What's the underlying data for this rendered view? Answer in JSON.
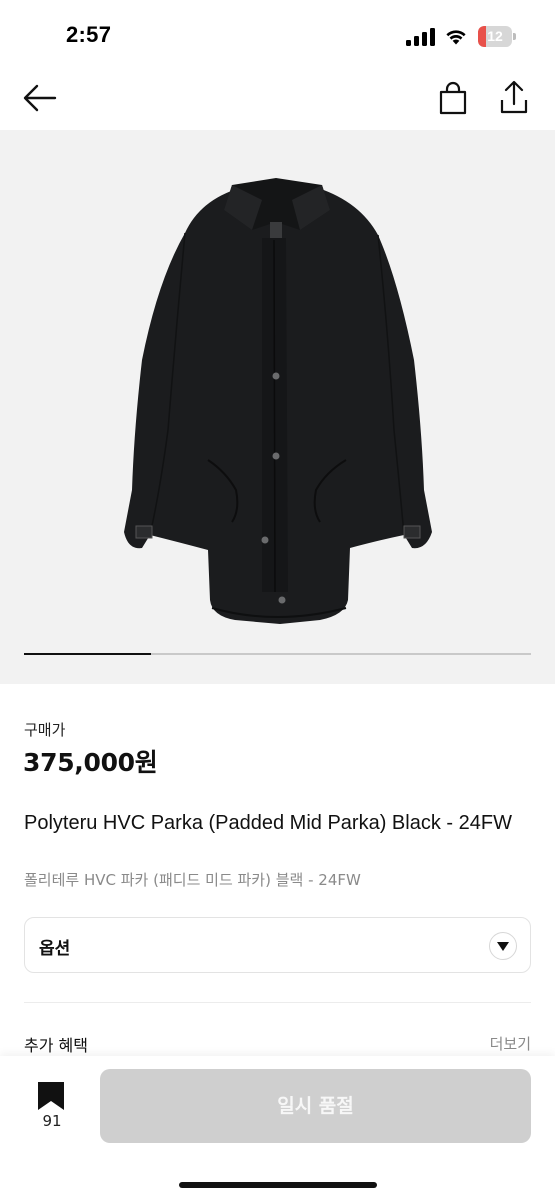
{
  "status_bar": {
    "time": "2:57",
    "battery_level": "12",
    "battery_color": "#e8514a"
  },
  "nav": {
    "back_icon": "arrow-left-icon",
    "bag_icon": "shopping-bag-icon",
    "share_icon": "share-icon"
  },
  "gallery": {
    "image_subject": "black-parka",
    "progress_fraction": 0.25
  },
  "product": {
    "price_label": "구매가",
    "price": "375,000원",
    "title": "Polyteru HVC Parka (Padded Mid Parka) Black - 24FW",
    "subtitle": "폴리테루 HVC 파카 (패디드 미드 파카) 블랙 - 24FW"
  },
  "option": {
    "label": "옵션",
    "icon": "chevron-down-icon"
  },
  "benefits": {
    "title": "추가 혜택",
    "more": "더보기"
  },
  "bottom_bar": {
    "bookmark_icon": "bookmark-icon",
    "bookmark_count": "91",
    "cta_label": "일시 품절",
    "cta_color": "#cfcfcf"
  }
}
